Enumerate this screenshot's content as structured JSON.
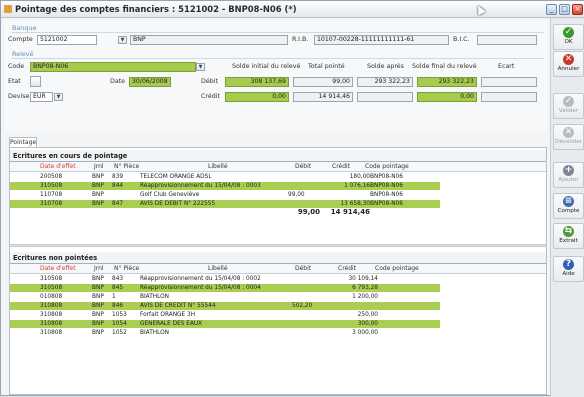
{
  "window": {
    "title": "Pointage des comptes financiers : 5121002 - BNP08-N06 (*)"
  },
  "banque": {
    "section_label": "Banque",
    "compte_label": "Compte",
    "compte_value": "5121002",
    "bank_name": "BNP",
    "rib_label": "R.I.B.",
    "rib_value": "10107-00228-11111111111-61",
    "bic_label": "B.I.C.",
    "bic_value": ""
  },
  "releve": {
    "section_label": "Relevé",
    "code_label": "Code",
    "code_value": "BNP08-N06",
    "etat_label": "Etat",
    "date_label": "Date",
    "date_value": "30/06/2008",
    "devise_label": "Devise",
    "devise_value": "EUR",
    "col_headers": [
      "Solde initial du relevé",
      "Total pointé",
      "Solde après",
      "Solde final du relevé",
      "Ecart"
    ],
    "debit_label": "Débit",
    "credit_label": "Crédit",
    "debit": {
      "solde_initial": "308 137,69",
      "total_pointe": "99,00",
      "solde_apres": "293 322,23",
      "solde_final": "293 322,23",
      "ecart": ""
    },
    "credit": {
      "solde_initial": "0,00",
      "total_pointe": "14 914,46",
      "solde_apres": "",
      "solde_final": "0,00",
      "ecart": ""
    }
  },
  "tabs": [
    {
      "label": "Pointage"
    }
  ],
  "columns": [
    "Date d'effet",
    "Jrnl",
    "N° Pièce",
    "Libellé",
    "Débit",
    "Crédit",
    "Code pointage"
  ],
  "en_cours": {
    "title": "Ecritures en cours de pointage",
    "rows": [
      {
        "date": "200508",
        "jrnl": "BNP",
        "piece": "839",
        "libelle": "TELECOM ORANGE ADSL",
        "debit": "",
        "credit": "180,00",
        "code": "BNP08-N06",
        "highlight": false
      },
      {
        "date": "310508",
        "jrnl": "BNP",
        "piece": "844",
        "libelle": "Réapprovisionnement du 15/04/08 : 0003",
        "debit": "",
        "credit": "1 076,16",
        "code": "BNP08-N06",
        "highlight": true
      },
      {
        "date": "110708",
        "jrnl": "BNP",
        "piece": "",
        "libelle": "Golf Club Geneviève",
        "debit": "99,00",
        "credit": "",
        "code": "BNP08-N06",
        "highlight": false
      },
      {
        "date": "310708",
        "jrnl": "BNP",
        "piece": "847",
        "libelle": "AVIS DE DEBIT N° 222555",
        "debit": "",
        "credit": "13 658,30",
        "code": "BNP08-N06",
        "highlight": true
      }
    ],
    "total_debit": "99,00",
    "total_credit": "14 914,46"
  },
  "non_pointees": {
    "title": "Ecritures non pointées",
    "rows": [
      {
        "date": "310508",
        "jrnl": "BNP",
        "piece": "843",
        "libelle": "Réapprovisionnement du 15/04/08 : 0002",
        "debit": "",
        "credit": "30 109,14",
        "code": "",
        "highlight": false
      },
      {
        "date": "310508",
        "jrnl": "BNP",
        "piece": "845",
        "libelle": "Réapprovisionnement du 15/04/08 : 0004",
        "debit": "",
        "credit": "6 793,28",
        "code": "",
        "highlight": true
      },
      {
        "date": "010808",
        "jrnl": "BNP",
        "piece": "1",
        "libelle": "BIATHLON",
        "debit": "",
        "credit": "1 200,00",
        "code": "",
        "highlight": false
      },
      {
        "date": "310808",
        "jrnl": "BNP",
        "piece": "846",
        "libelle": "AVIS DE CREDIT N° 55544",
        "debit": "502,20",
        "credit": "",
        "code": "",
        "highlight": true
      },
      {
        "date": "310808",
        "jrnl": "BNP",
        "piece": "1053",
        "libelle": "Forfait ORANGE 3H",
        "debit": "",
        "credit": "250,00",
        "code": "",
        "highlight": false
      },
      {
        "date": "310808",
        "jrnl": "BNP",
        "piece": "1054",
        "libelle": "GENERALE DES EAUX",
        "debit": "",
        "credit": "300,00",
        "code": "",
        "highlight": true
      },
      {
        "date": "310808",
        "jrnl": "BNP",
        "piece": "1052",
        "libelle": "BIATHLON",
        "debit": "",
        "credit": "3 000,00",
        "code": "",
        "highlight": false
      }
    ]
  },
  "sidebar": [
    {
      "label": "OK",
      "icon": "check-icon",
      "color": "#3a9a2e",
      "enabled": true
    },
    {
      "label": "Annuler",
      "icon": "cancel-icon",
      "color": "#c9372c",
      "enabled": true
    },
    {
      "label": "Valider",
      "icon": "validate-icon",
      "color": "#b7bcc2",
      "enabled": false
    },
    {
      "label": "Dévalider",
      "icon": "devalidate-icon",
      "color": "#b7bcc2",
      "enabled": false
    },
    {
      "label": "Ajouter",
      "icon": "add-icon",
      "color": "#7c8894",
      "enabled": false
    },
    {
      "label": "Compte",
      "icon": "account-icon",
      "color": "#3f6fa8",
      "enabled": true
    },
    {
      "label": "Extrait",
      "icon": "extract-icon",
      "color": "#4d9b3a",
      "enabled": true
    },
    {
      "label": "Aide",
      "icon": "help-icon",
      "color": "#2e62b6",
      "enabled": true
    }
  ],
  "colors": {
    "highlight": "#a9ce52",
    "section_label": "#5b8fc7",
    "date_header": "#d63b2f"
  }
}
